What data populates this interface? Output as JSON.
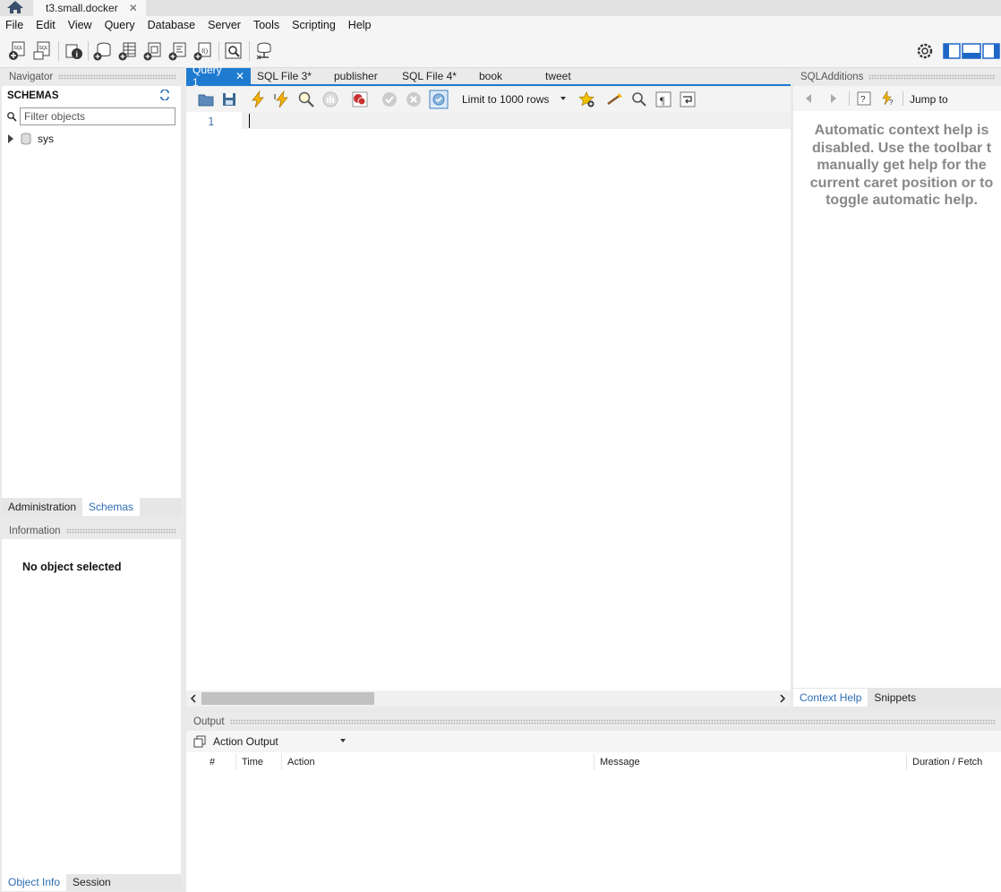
{
  "connection_tab": {
    "label": "t3.small.docker"
  },
  "menu": [
    "File",
    "Edit",
    "View",
    "Query",
    "Database",
    "Server",
    "Tools",
    "Scripting",
    "Help"
  ],
  "navigator": {
    "title": "Navigator",
    "schemas_label": "SCHEMAS",
    "filter_placeholder": "Filter objects",
    "schemas": [
      "sys"
    ],
    "tabs": {
      "administration": "Administration",
      "schemas": "Schemas"
    }
  },
  "information": {
    "title": "Information",
    "empty_text": "No object selected",
    "tabs": {
      "object_info": "Object Info",
      "session": "Session"
    }
  },
  "query_tabs": [
    "Query 1",
    "SQL File 3*",
    "publisher",
    "SQL File 4*",
    "book",
    "tweet"
  ],
  "editor": {
    "limit_label": "Limit to 1000 rows",
    "line_number": "1"
  },
  "sql_additions": {
    "title": "SQLAdditions",
    "jump_to": "Jump to",
    "help_lines": [
      "Automatic context help is",
      "disabled. Use the toolbar t",
      "manually get help for the",
      "current caret position or to",
      "toggle automatic help."
    ],
    "tabs": {
      "context_help": "Context Help",
      "snippets": "Snippets"
    }
  },
  "output": {
    "title": "Output",
    "selector": "Action Output",
    "columns": {
      "num": "#",
      "time": "Time",
      "action": "Action",
      "message": "Message",
      "duration": "Duration / Fetch"
    }
  },
  "colors": {
    "accent": "#1e7bd0",
    "tab_text_active": "#2d6db5"
  }
}
